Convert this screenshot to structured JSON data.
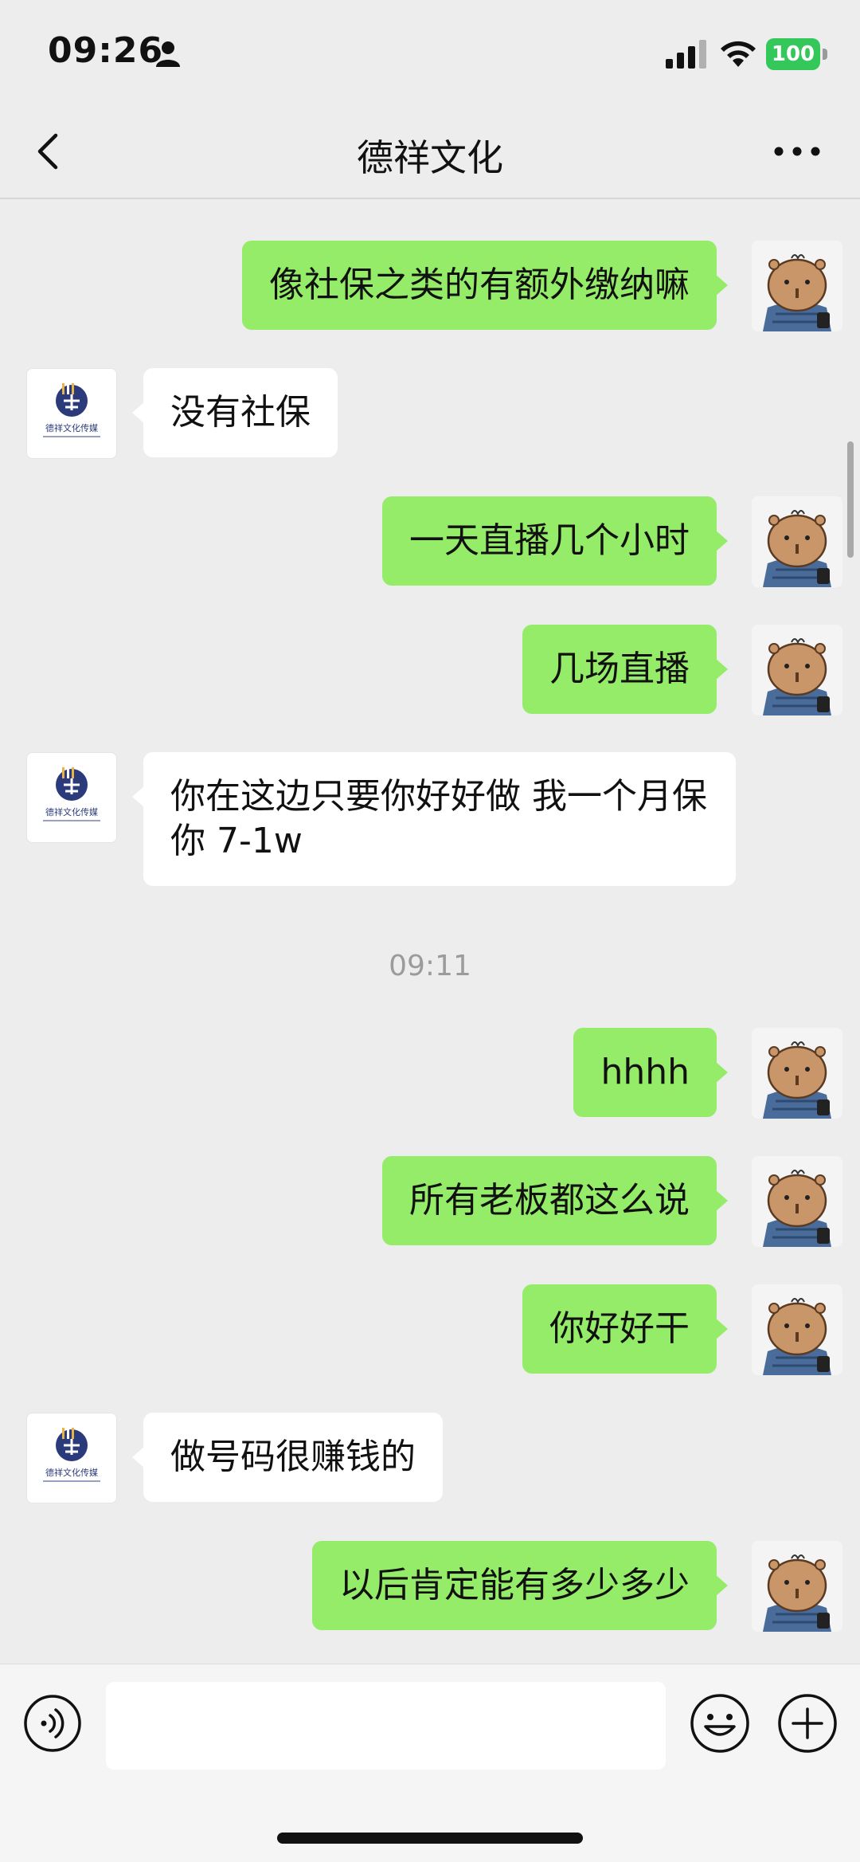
{
  "status_bar": {
    "time": "09:26",
    "battery": "100"
  },
  "nav": {
    "title": "德祥文化"
  },
  "logo_text": "德祥文化传媒",
  "messages": [
    {
      "side": "me",
      "text": "像社保之类的有额外缴纳嘛"
    },
    {
      "side": "them",
      "text": "没有社保"
    },
    {
      "side": "me",
      "text": "一天直播几个小时"
    },
    {
      "side": "me",
      "text": "几场直播"
    },
    {
      "side": "them",
      "text": " 你在这边只要你好好做 我一个月保你 7-1w"
    },
    {
      "side": "me",
      "text": "hhhh"
    },
    {
      "side": "me",
      "text": "所有老板都这么说"
    },
    {
      "side": "me",
      "text": "你好好干"
    },
    {
      "side": "them",
      "text": "做号码很赚钱的"
    },
    {
      "side": "me",
      "text": "以后肯定能有多少多少"
    }
  ],
  "timestamp": "09:11",
  "input": {
    "value": "",
    "placeholder": ""
  },
  "colors": {
    "me_bubble": "#95ec69",
    "them_bubble": "#ffffff",
    "background": "#ededed",
    "battery": "#34c759"
  }
}
